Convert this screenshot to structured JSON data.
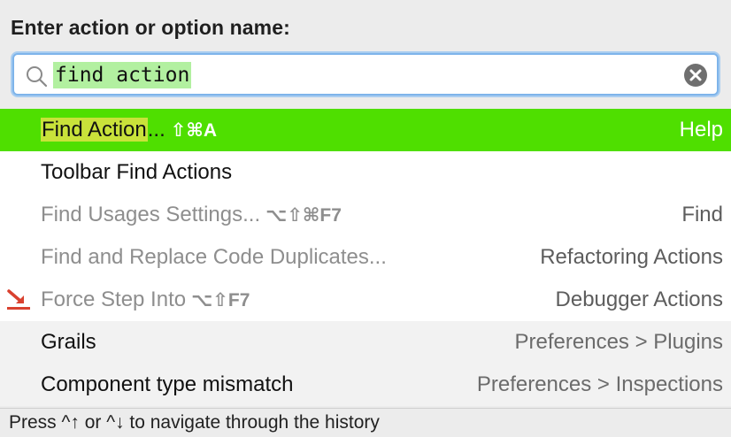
{
  "header": {
    "title": "Enter action or option name:"
  },
  "search": {
    "value": "find action"
  },
  "results": [
    {
      "name_hl": "Find Action",
      "name_rest": "...",
      "shortcut": "⇧⌘A",
      "group": "Help",
      "state": "selected"
    },
    {
      "name": "Toolbar Find Actions",
      "shortcut": "",
      "group": "",
      "state": "normal"
    },
    {
      "name": "Find Usages Settings...",
      "shortcut": "⌥⇧⌘F7",
      "group": "Find",
      "state": "disabled"
    },
    {
      "name": "Find and Replace Code Duplicates...",
      "shortcut": "",
      "group": "Refactoring Actions",
      "state": "disabled"
    },
    {
      "name": "Force Step Into",
      "shortcut": "⌥⇧F7",
      "group": "Debugger Actions",
      "state": "disabled",
      "icon": "force-step-into-icon"
    },
    {
      "name": "Grails",
      "shortcut": "",
      "group": "Preferences > Plugins",
      "state": "option"
    },
    {
      "name": "Component type mismatch",
      "shortcut": "",
      "group": "Preferences > Inspections",
      "state": "option"
    }
  ],
  "footer": {
    "hint": "Press ^↑ or ^↓ to navigate through the history"
  },
  "colors": {
    "selected_row": "#4fdf00",
    "search_highlight": "#b2f0a0",
    "match_highlight": "#c9e23a",
    "focus_border": "#7eb4ea"
  }
}
